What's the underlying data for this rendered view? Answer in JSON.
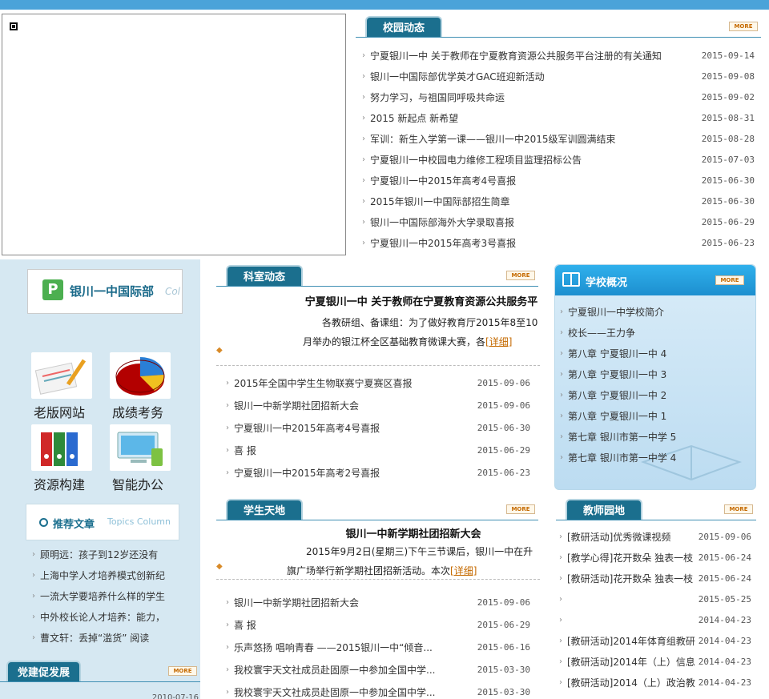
{
  "campus_news": {
    "title": "校园动态",
    "more": "MORE",
    "items": [
      {
        "text": "宁夏银川一中 关于教师在宁夏教育资源公共服务平台注册的有关通知",
        "date": "2015-09-14"
      },
      {
        "text": "银川一中国际部优学英才GAC班迎新活动",
        "date": "2015-09-08"
      },
      {
        "text": "努力学习，与祖国同呼吸共命运",
        "date": "2015-09-02"
      },
      {
        "text": "2015 新起点 新希望",
        "date": "2015-08-31"
      },
      {
        "text": "军训：新生入学第一课——银川一中2015级军训圆满结束",
        "date": "2015-08-28"
      },
      {
        "text": "宁夏银川一中校园电力维修工程项目监理招标公告",
        "date": "2015-07-03"
      },
      {
        "text": "宁夏银川一中2015年高考4号喜报",
        "date": "2015-06-30"
      },
      {
        "text": "2015年银川一中国际部招生简章",
        "date": "2015-06-30"
      },
      {
        "text": "银川一中国际部海外大学录取喜报",
        "date": "2015-06-29"
      },
      {
        "text": "宁夏银川一中2015年高考3号喜报",
        "date": "2015-06-23"
      }
    ]
  },
  "intl": {
    "p": "P",
    "name": "银川一中国际部",
    "col": "Col"
  },
  "icons": [
    {
      "name": "old-site-icon",
      "label": "老版网站"
    },
    {
      "name": "grades-icon",
      "label": "成绩考务"
    },
    {
      "name": "resources-icon",
      "label": "资源构建"
    },
    {
      "name": "office-icon",
      "label": "智能办公"
    }
  ],
  "topics": {
    "title": "推荐文章",
    "sub": "Topics Column",
    "items": [
      "顾明远：孩子到12岁还没有",
      "上海中学人才培养模式创新纪",
      "一流大学要培养什么样的学生",
      "中外校长论人才培养：能力，",
      "曹文轩：丢掉“滥货” 阅读"
    ]
  },
  "party": {
    "title": "党建促发展",
    "more": "MORE",
    "date": "2010-07-16"
  },
  "dept": {
    "title": "科室动态",
    "more": "MORE",
    "feature_title": "宁夏银川一中 关于教师在宁夏教育资源公共服务平",
    "feature_body": "各教研组、备课组：为了做好教育厅2015年8至10月举办的银江杯全区基础教育微课大赛，各",
    "feature_link": "[详细]",
    "items": [
      {
        "text": "2015年全国中学生生物联赛宁夏赛区喜报",
        "date": "2015-09-06"
      },
      {
        "text": "银川一中新学期社团招新大会",
        "date": "2015-09-06"
      },
      {
        "text": "宁夏银川一中2015年高考4号喜报",
        "date": "2015-06-30"
      },
      {
        "text": "喜 报",
        "date": "2015-06-29"
      },
      {
        "text": "宁夏银川一中2015年高考2号喜报",
        "date": "2015-06-23"
      }
    ]
  },
  "students": {
    "title": "学生天地",
    "more": "MORE",
    "feature_title": "银川一中新学期社团招新大会",
    "feature_body": "2015年9月2日(星期三)下午三节课后，银川一中在升旗广场举行新学期社团招新活动。本次",
    "feature_link": "[详细]",
    "items": [
      {
        "text": "银川一中新学期社团招新大会",
        "date": "2015-09-06"
      },
      {
        "text": "喜 报",
        "date": "2015-06-29"
      },
      {
        "text": "乐声悠扬 唱响青春 ——2015银川一中“倾音...",
        "date": "2015-06-16"
      },
      {
        "text": "我校寰宇天文社成员赴固原一中参加全国中学...",
        "date": "2015-03-30"
      },
      {
        "text": "我校寰宇天文社成员赴固原一中参加全国中学...",
        "date": "2015-03-30"
      }
    ]
  },
  "school": {
    "title": "学校概况",
    "more": "MORE",
    "items": [
      "宁夏银川一中学校简介",
      "校长——王力争",
      "第八章 宁夏银川一中 4",
      "第八章 宁夏银川一中 3",
      "第八章 宁夏银川一中 2",
      "第八章 宁夏银川一中 1",
      "第七章 银川市第一中学 5",
      "第七章 银川市第一中学 4"
    ]
  },
  "teachers": {
    "title": "教师园地",
    "more": "MORE",
    "items": [
      {
        "text": "[教研活动]优秀微课视频",
        "date": "2015-09-06"
      },
      {
        "text": "[教学心得]花开数朵 独表一枝",
        "date": "2015-06-24"
      },
      {
        "text": "[教研活动]花开数朵 独表一枝",
        "date": "2015-06-24"
      },
      {
        "text": "",
        "date": "2015-05-25"
      },
      {
        "text": "",
        "date": "2014-04-23"
      },
      {
        "text": "[教研活动]2014年体育组教研",
        "date": "2014-04-23"
      },
      {
        "text": "[教研活动]2014年（上）信息",
        "date": "2014-04-23"
      },
      {
        "text": "[教研活动]2014（上）政治教",
        "date": "2014-04-23"
      }
    ]
  }
}
